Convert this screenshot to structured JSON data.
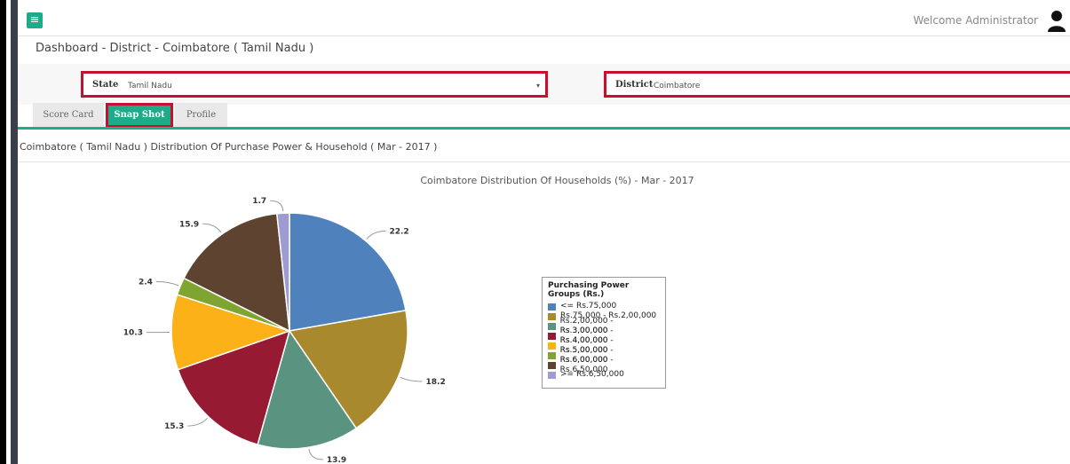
{
  "header": {
    "welcome": "Welcome Administrator",
    "menu_icon": "hamburger-icon",
    "user_icon": "user-icon"
  },
  "breadcrumb": "Dashboard - District - Coimbatore ( Tamil Nadu )",
  "filters": {
    "state_label": "State",
    "state_value": "Tamil Nadu",
    "district_label": "District",
    "district_value": "Coimbatore"
  },
  "tabs": [
    {
      "label": "Score Card",
      "active": false
    },
    {
      "label": "Snap Shot",
      "active": true
    },
    {
      "label": "Profile",
      "active": false
    }
  ],
  "section_title": "Coimbatore ( Tamil Nadu ) Distribution Of Purchase Power & Household ( Mar - 2017 )",
  "colors": {
    "accent": "#1eab8a",
    "highlight": "#c8102e"
  },
  "chart_data": {
    "type": "pie",
    "title": "Coimbatore Distribution Of Households (%) - Mar - 2017",
    "legend_title": "Purchasing Power Groups (Rs.)",
    "legend_position": "right",
    "slices": [
      {
        "label": "<= Rs.75,000",
        "value": 22.2,
        "color": "#4f81bd"
      },
      {
        "label": "Rs.75,000 - Rs.2,00,000",
        "value": 18.2,
        "color": "#a9892d"
      },
      {
        "label": "Rs.2,00,000 - Rs.3,00,000",
        "value": 13.9,
        "color": "#5a9480"
      },
      {
        "label": "Rs.3,00,000 - Rs.4,00,000",
        "value": 15.3,
        "color": "#951a32"
      },
      {
        "label": "Rs.4,00,000 - Rs.5,00,000",
        "value": 10.3,
        "color": "#fbb117"
      },
      {
        "label": "Rs.5,00,000 - Rs.6,00,000",
        "value": 2.4,
        "color": "#7fa431"
      },
      {
        "label": "Rs.6,00,000 - Rs.6,50,000",
        "value": 15.9,
        "color": "#5e4430"
      },
      {
        "label": ">= Rs.6,50,000",
        "value": 1.7,
        "color": "#9e9ad2"
      }
    ]
  }
}
